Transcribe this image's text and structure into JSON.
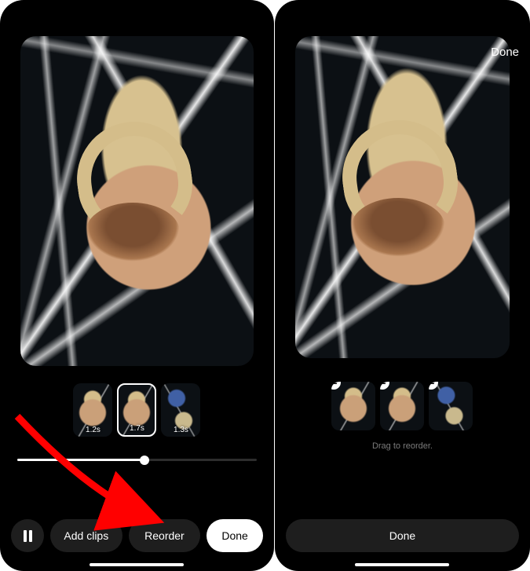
{
  "left": {
    "controls": {
      "add_clips": "Add clips",
      "reorder": "Reorder",
      "done": "Done"
    },
    "thumbs": [
      {
        "duration": "1.2s",
        "selected": false,
        "variant": "basket"
      },
      {
        "duration": "1.7s",
        "selected": true,
        "variant": "basket"
      },
      {
        "duration": "1.3s",
        "selected": false,
        "variant": "alt"
      }
    ]
  },
  "right": {
    "top_done": "Done",
    "hint": "Drag to reorder.",
    "done": "Done",
    "thumbs": [
      {
        "minus": "–",
        "variant": "basket"
      },
      {
        "minus": "–",
        "variant": "basket"
      },
      {
        "minus": "–",
        "variant": "alt"
      }
    ]
  }
}
